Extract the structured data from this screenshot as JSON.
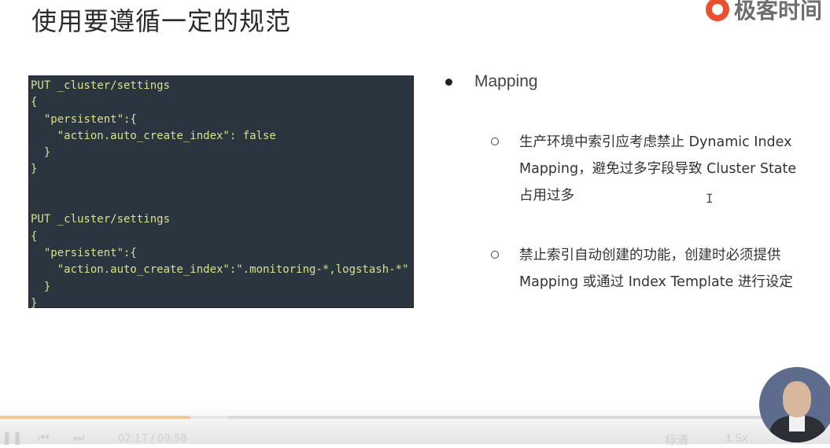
{
  "slide": {
    "title": "使用要遵循一定的规范",
    "logo_text": "极客时间"
  },
  "code": {
    "lines": [
      "PUT _cluster/settings",
      "{",
      "  \"persistent\":{",
      "    \"action.auto_create_index\": false",
      "  }",
      "}",
      "",
      "",
      "PUT _cluster/settings",
      "{",
      "  \"persistent\":{",
      "    \"action.auto_create_index\":\".monitoring-*,logstash-*\"",
      "  }",
      "}"
    ]
  },
  "bullets": {
    "main": "Mapping",
    "sub1_lines": [
      "生产环境中索引应考虑禁止 Dynamic Index",
      "Mapping，避免过多字段导致 Cluster State",
      "占用过多"
    ],
    "sub2_lines": [
      "禁止索引自动创建的功能，创建时必须提供",
      "Mapping 或通过 Index Template 进行设定"
    ]
  },
  "player": {
    "current_time": "02:17",
    "duration": "09:58",
    "time_display": "02:17 / 09:58",
    "quality": "标清",
    "speed": "1.5x",
    "progress_fraction": 0.229,
    "buffered_fraction": 0.275
  },
  "colors": {
    "code_bg": "#2b3540",
    "code_text": "#d6e18a",
    "logo_accent": "#e8502f",
    "progress_fill": "#f2c79a"
  }
}
